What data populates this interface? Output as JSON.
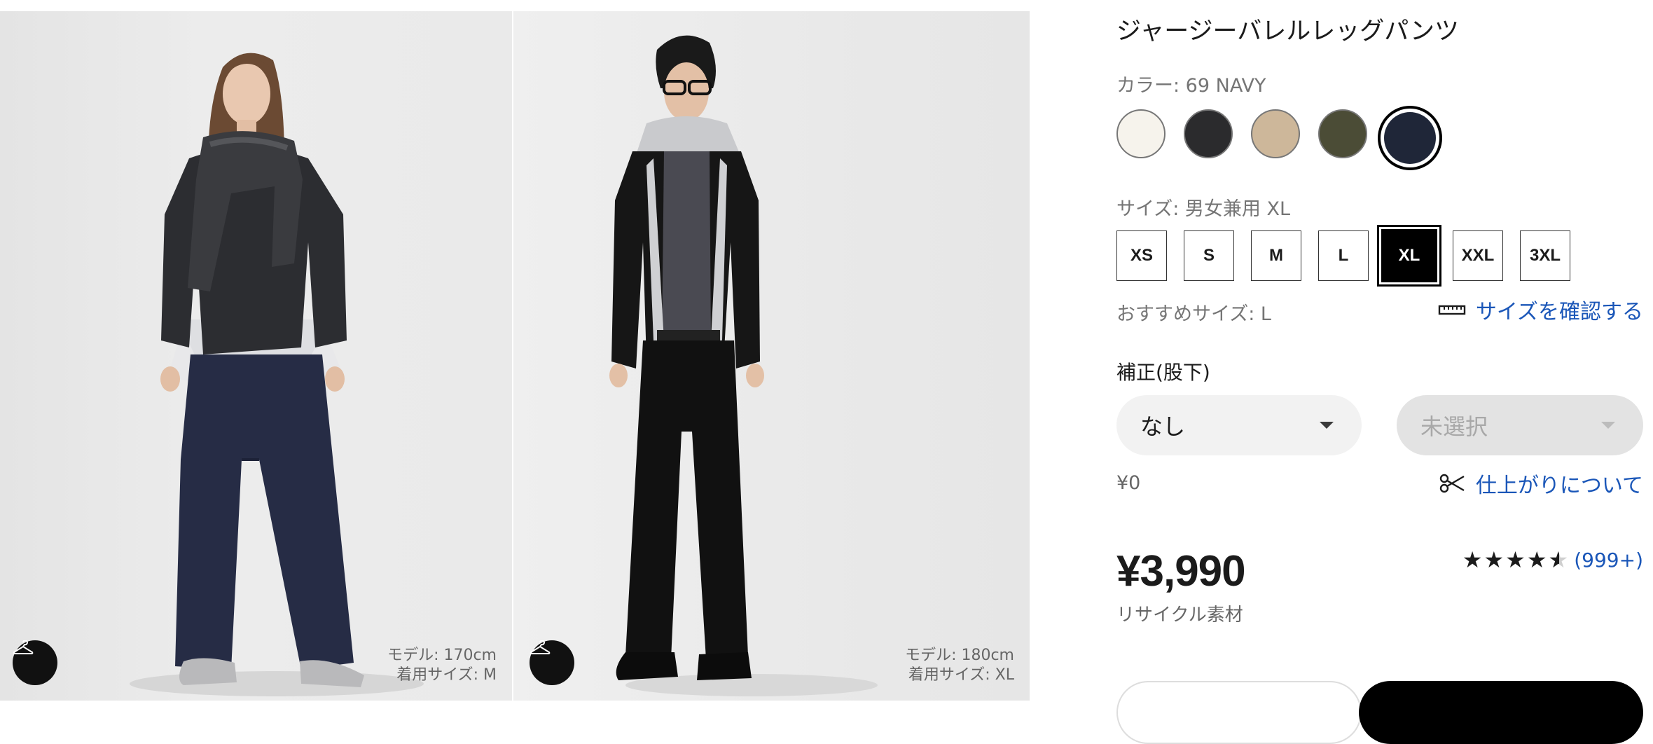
{
  "gallery": {
    "photos": [
      {
        "model_height": "モデル: 170cm",
        "model_size": "着用サイズ: M"
      },
      {
        "model_height": "モデル: 180cm",
        "model_size": "着用サイズ: XL"
      }
    ]
  },
  "product": {
    "name": "ジャージーバレルレッグパンツ",
    "color_label": "カラー: 69 NAVY",
    "colors": [
      {
        "name": "off-white",
        "hex": "#f6f3ec"
      },
      {
        "name": "black",
        "hex": "#2b2b2d"
      },
      {
        "name": "beige",
        "hex": "#cdb79a"
      },
      {
        "name": "olive",
        "hex": "#4b4c36"
      },
      {
        "name": "navy",
        "hex": "#1f2638",
        "selected": true
      }
    ],
    "size_label": "サイズ: 男女兼用 XL",
    "sizes": [
      "XS",
      "S",
      "M",
      "L",
      "XL",
      "XXL",
      "3XL"
    ],
    "selected_size": "XL",
    "recommended_size": "おすすめサイズ: L",
    "size_check_link": "サイズを確認する",
    "alteration_label": "補正(股下)",
    "alteration_select": "なし",
    "length_select": "未選択",
    "alteration_price": "¥0",
    "finish_link": "仕上がりについて",
    "price": "¥3,990",
    "material_note": "リサイクル素材",
    "rating_value": 4.5,
    "review_count": "(999+)"
  },
  "colors": {
    "link": "#1a56b8",
    "text": "#1b1b1b",
    "muted": "#757575"
  }
}
